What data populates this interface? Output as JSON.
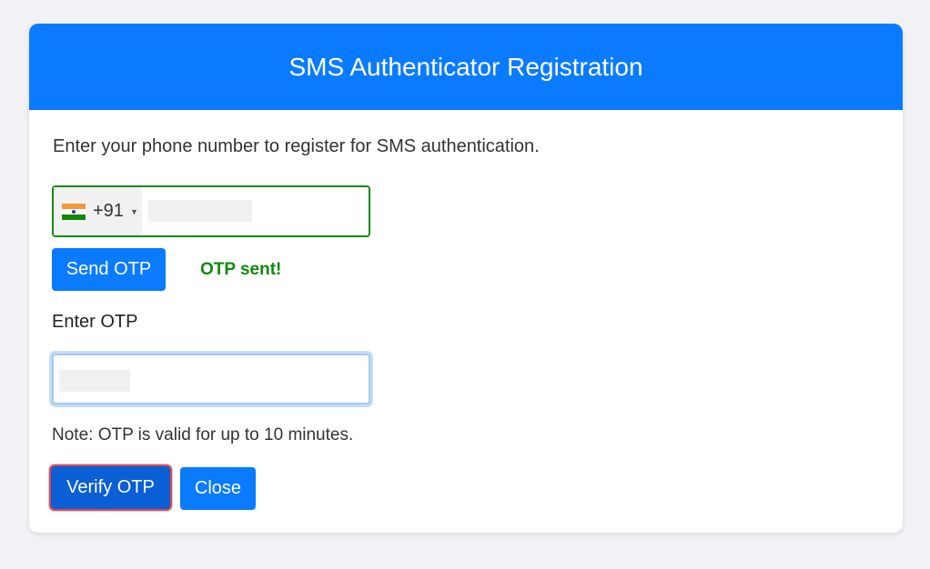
{
  "header": {
    "title": "SMS Authenticator Registration"
  },
  "intro_text": "Enter your phone number to register for SMS authentication.",
  "phone": {
    "country_flag": "india-flag-icon",
    "dial_code": "+91",
    "value": ""
  },
  "send_button": {
    "label": "Send OTP"
  },
  "status": {
    "message": "OTP sent!",
    "color": "#108a10"
  },
  "otp": {
    "label": "Enter OTP",
    "value": ""
  },
  "note": "Note: OTP is valid for up to 10 minutes.",
  "actions": {
    "verify_label": "Verify OTP",
    "close_label": "Close"
  },
  "colors": {
    "primary": "#0a7bfe",
    "success": "#108a10",
    "focus_outline": "#d94a55"
  }
}
